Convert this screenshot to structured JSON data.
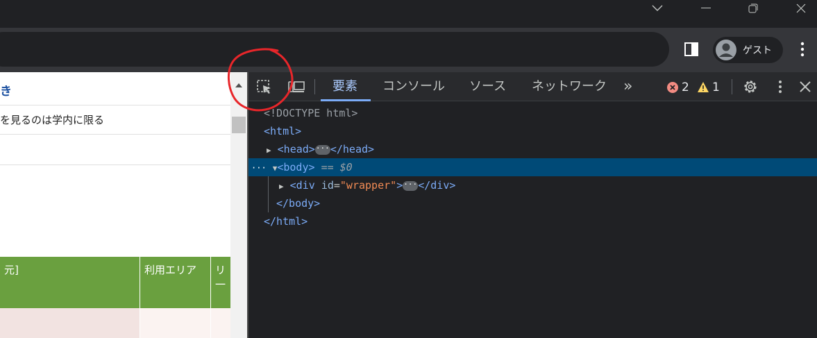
{
  "window": {
    "controls": [
      "chevron-down-icon",
      "minimize-icon",
      "restore-icon",
      "close-icon"
    ]
  },
  "toolbar": {
    "profile_label": "ゲスト"
  },
  "page": {
    "row1_text": "き",
    "row2_text": "を見るのは学内に限る",
    "table_headers": [
      "元]",
      "利用エリア",
      "リ一"
    ]
  },
  "devtools": {
    "tabs": [
      "要素",
      "コンソール",
      "ソース",
      "ネットワーク"
    ],
    "more_tabs": "»",
    "error_count": "2",
    "warning_count": "1",
    "dom": {
      "doctype": "<!DOCTYPE html>",
      "html_open": "<html>",
      "head_open": "<head>",
      "head_close": "</head>",
      "body_open": "<body>",
      "body_marker": "== $0",
      "div_open_tag": "<div",
      "div_attr_name": "id",
      "div_attr_value": "\"wrapper\"",
      "div_close": "</div>",
      "body_close": "</body>",
      "html_close": "</html>",
      "ellipsis": "···"
    }
  },
  "colors": {
    "accent": "#7cacf8",
    "error": "#f28b82",
    "warning": "#fdd663",
    "table_header": "#6aa03f",
    "annotation": "#e8262a"
  }
}
